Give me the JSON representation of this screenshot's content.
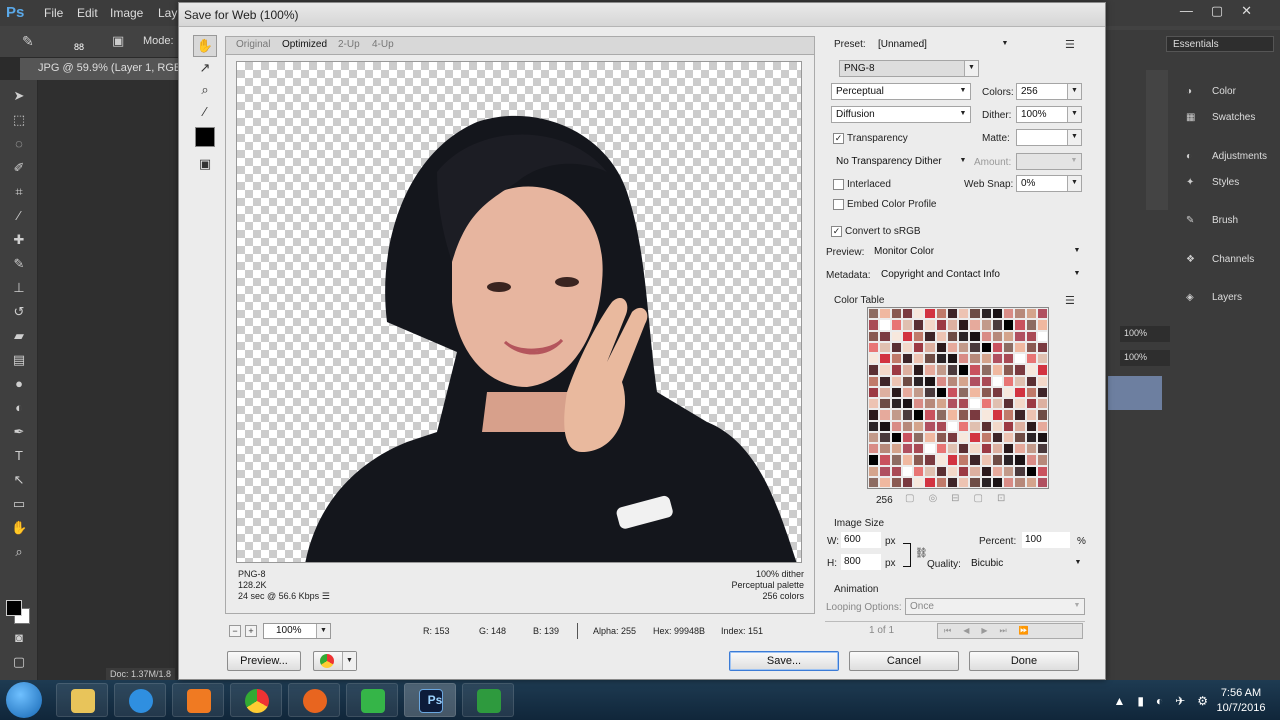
{
  "photoshop": {
    "logo": "Ps",
    "menu": [
      "File",
      "Edit",
      "Image",
      "Lay"
    ],
    "options_bar": {
      "brush_size": "88",
      "mode_label": "Mode:"
    },
    "doc_tab": "JPG @ 59.9% (Layer 1, RGB/",
    "doc_info": "Doc: 1.37M/1.8",
    "workspace": "Essentials",
    "panels": [
      {
        "label": "Color",
        "icon": "color-wheel-icon"
      },
      {
        "label": "Swatches",
        "icon": "swatches-grid-icon"
      },
      {
        "label": "Adjustments",
        "icon": "adjustments-icon"
      },
      {
        "label": "Styles",
        "icon": "styles-icon"
      },
      {
        "label": "Brush",
        "icon": "brush-icon"
      },
      {
        "label": "Channels",
        "icon": "channels-icon"
      },
      {
        "label": "Layers",
        "icon": "layers-icon"
      }
    ],
    "layer_opacity": "100%",
    "layer_fill": "100%"
  },
  "dialog": {
    "title": "Save for Web (100%)",
    "view_tabs": [
      "Original",
      "Optimized",
      "2-Up",
      "4-Up"
    ],
    "active_tab": "Optimized",
    "preview_info": {
      "format": "PNG-8",
      "size": "128.2K",
      "time": "24 sec @ 56.6 Kbps",
      "dither": "100% dither",
      "palette": "Perceptual palette",
      "colors": "256 colors"
    },
    "statusbar": {
      "zoom": "100%",
      "r": "R: 153",
      "g": "G: 148",
      "b": "B: 139",
      "alpha": "Alpha: 255",
      "hex": "Hex: 99948B",
      "index": "Index: 151"
    },
    "buttons": {
      "preview": "Preview...",
      "save": "Save...",
      "cancel": "Cancel",
      "done": "Done"
    },
    "settings": {
      "preset_label": "Preset:",
      "preset_value": "[Unnamed]",
      "format": "PNG-8",
      "reduction": "Perceptual",
      "colors_label": "Colors:",
      "colors_value": "256",
      "dither_algorithm": "Diffusion",
      "dither_label": "Dither:",
      "dither_value": "100%",
      "transparency_label": "Transparency",
      "transparency_checked": true,
      "matte_label": "Matte:",
      "transparency_dither": "No Transparency Dither",
      "amount_label": "Amount:",
      "interlaced_label": "Interlaced",
      "interlaced_checked": false,
      "web_snap_label": "Web Snap:",
      "web_snap_value": "0%",
      "embed_profile_label": "Embed Color Profile",
      "embed_profile_checked": false,
      "convert_srgb_label": "Convert to sRGB",
      "convert_srgb_checked": true,
      "preview_label": "Preview:",
      "preview_value": "Monitor Color",
      "metadata_label": "Metadata:",
      "metadata_value": "Copyright and Contact Info",
      "color_table_label": "Color Table",
      "color_count": "256"
    },
    "image_size": {
      "label": "Image Size",
      "w_label": "W:",
      "w_value": "600",
      "h_label": "H:",
      "h_value": "800",
      "unit": "px",
      "percent_label": "Percent:",
      "percent_value": "100",
      "percent_unit": "%",
      "quality_label": "Quality:",
      "quality_value": "Bicubic"
    },
    "animation": {
      "label": "Animation",
      "looping_label": "Looping Options:",
      "looping_value": "Once",
      "frame": "1 of 1"
    }
  },
  "taskbar": {
    "apps": [
      "file-explorer",
      "internet-explorer",
      "media-player",
      "chrome",
      "firefox",
      "green-app",
      "photoshop",
      "camtasia"
    ],
    "photoshop_label": "Ps",
    "time": "7:56 AM",
    "date": "10/7/2016"
  },
  "colors": {
    "accent": "#3b7bd6",
    "dialog_bg": "#ececec",
    "ps_dark": "#3c3c3c"
  }
}
